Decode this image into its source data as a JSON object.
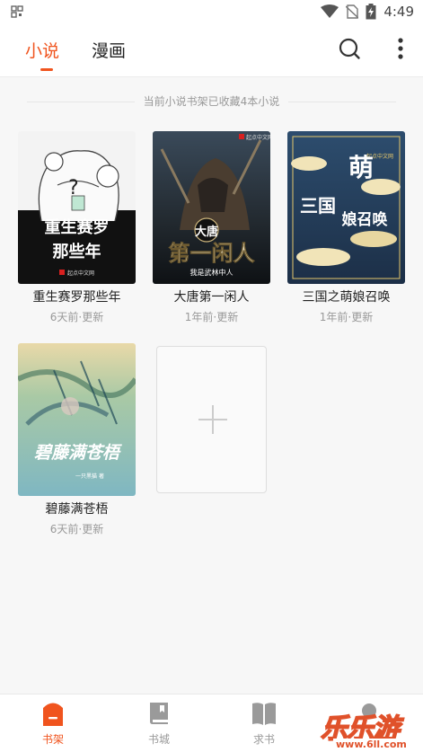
{
  "status_bar": {
    "time": "4:49",
    "icons": [
      "qr-icon",
      "wifi-icon",
      "no-sim-icon",
      "battery-charging-icon"
    ]
  },
  "header": {
    "tabs": [
      {
        "label": "小说",
        "active": true
      },
      {
        "label": "漫画",
        "active": false
      }
    ],
    "icons": [
      "search-icon",
      "more-vertical-icon"
    ]
  },
  "shelf": {
    "notice": "当前小说书架已收藏4本小说",
    "books": [
      {
        "title": "重生赛罗那些年",
        "meta": "6天前·更新",
        "cover_text": [
          "重生赛罗",
          "那些年"
        ],
        "cover_publisher": "起点中文网",
        "cover_question": "?"
      },
      {
        "title": "大唐第一闲人",
        "meta": "1年前·更新",
        "cover_top": "起点中文网",
        "cover_big": "大唐",
        "cover_text": "第一闲人",
        "cover_sub": "我是武林中人"
      },
      {
        "title": "三国之萌娘召唤",
        "meta": "1年前·更新",
        "cover_text_a": "萌",
        "cover_text_b": "三国",
        "cover_text_c": "娘召唤",
        "cover_top": "起点中文网"
      },
      {
        "title": "碧藤满苍梧",
        "meta": "6天前·更新",
        "cover_text": "碧藤满苍梧",
        "cover_sub": "一只黑猫 著"
      }
    ],
    "add_button_icon": "plus-icon"
  },
  "bottom_nav": {
    "items": [
      {
        "label": "书架",
        "icon": "bookshelf-icon",
        "active": true
      },
      {
        "label": "书城",
        "icon": "book-icon",
        "active": false
      },
      {
        "label": "求书",
        "icon": "open-book-icon",
        "active": false
      },
      {
        "label": "",
        "icon": "profile-icon",
        "active": false
      }
    ]
  },
  "watermark": {
    "text": "乐乐游戏",
    "url": "www.6ll.com"
  },
  "colors": {
    "accent": "#f0541e",
    "background": "#f7f7f7",
    "muted": "#999999"
  }
}
